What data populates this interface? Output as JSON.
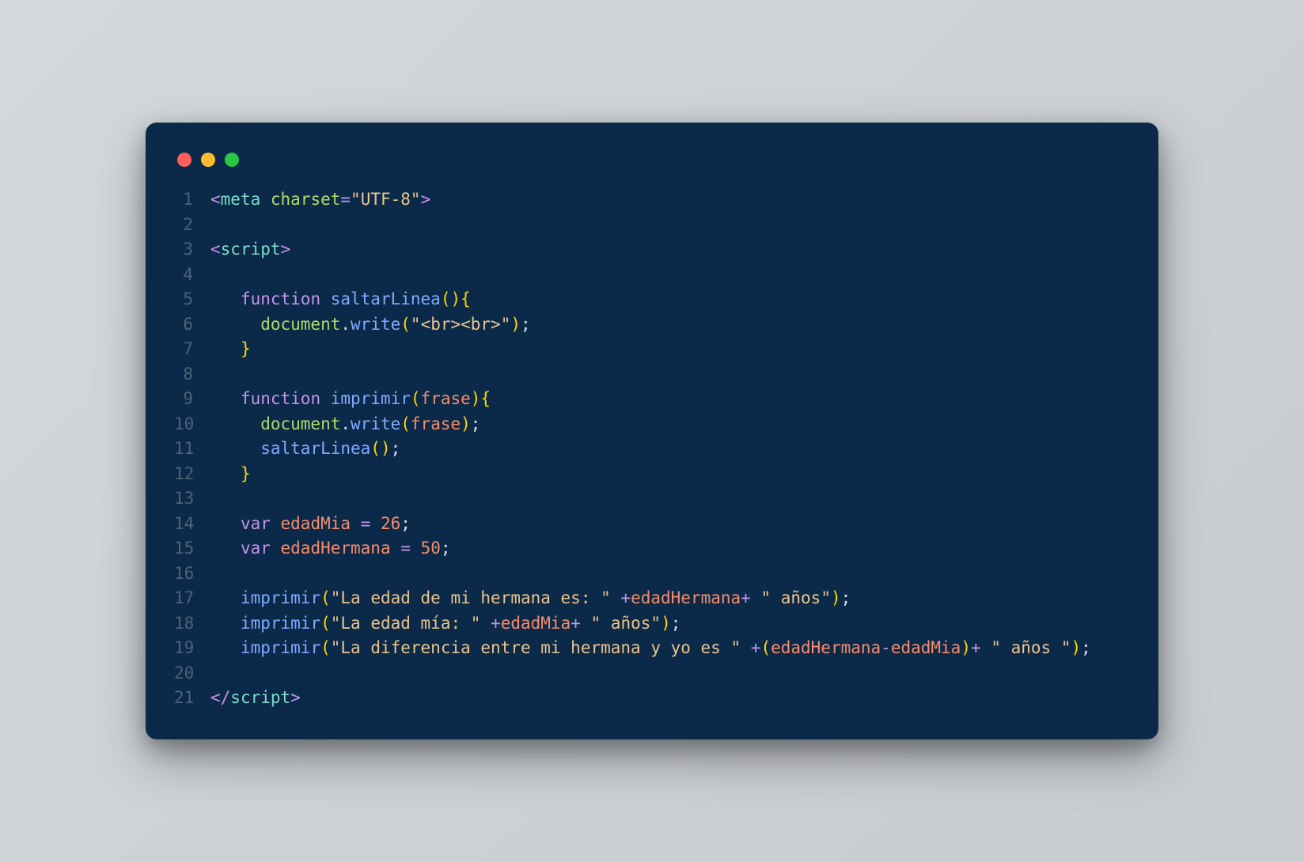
{
  "window": {
    "traffic_lights": [
      "close",
      "minimize",
      "zoom"
    ]
  },
  "code": {
    "lines": [
      {
        "n": "1",
        "tokens": [
          {
            "t": "<",
            "c": "angle"
          },
          {
            "t": "meta ",
            "c": "tag"
          },
          {
            "t": "charset",
            "c": "attr"
          },
          {
            "t": "=",
            "c": "op"
          },
          {
            "t": "\"UTF-8\"",
            "c": "str"
          },
          {
            "t": ">",
            "c": "angle"
          }
        ]
      },
      {
        "n": "2",
        "tokens": []
      },
      {
        "n": "3",
        "tokens": [
          {
            "t": "<",
            "c": "angle"
          },
          {
            "t": "script",
            "c": "tag"
          },
          {
            "t": ">",
            "c": "angle"
          }
        ]
      },
      {
        "n": "4",
        "tokens": []
      },
      {
        "n": "5",
        "tokens": [
          {
            "t": "   ",
            "c": "code"
          },
          {
            "t": "function ",
            "c": "kw"
          },
          {
            "t": "saltarLinea",
            "c": "fn"
          },
          {
            "t": "()",
            "c": "paren"
          },
          {
            "t": "{",
            "c": "brace"
          }
        ]
      },
      {
        "n": "6",
        "tokens": [
          {
            "t": "     ",
            "c": "code"
          },
          {
            "t": "document",
            "c": "obj"
          },
          {
            "t": ".",
            "c": "punct"
          },
          {
            "t": "write",
            "c": "fn"
          },
          {
            "t": "(",
            "c": "paren"
          },
          {
            "t": "\"<br><br>\"",
            "c": "str"
          },
          {
            "t": ")",
            "c": "paren"
          },
          {
            "t": ";",
            "c": "punct"
          }
        ]
      },
      {
        "n": "7",
        "tokens": [
          {
            "t": "   ",
            "c": "code"
          },
          {
            "t": "}",
            "c": "brace"
          }
        ]
      },
      {
        "n": "8",
        "tokens": []
      },
      {
        "n": "9",
        "tokens": [
          {
            "t": "   ",
            "c": "code"
          },
          {
            "t": "function ",
            "c": "kw"
          },
          {
            "t": "imprimir",
            "c": "fn"
          },
          {
            "t": "(",
            "c": "paren"
          },
          {
            "t": "frase",
            "c": "var"
          },
          {
            "t": ")",
            "c": "paren"
          },
          {
            "t": "{",
            "c": "brace"
          }
        ]
      },
      {
        "n": "10",
        "tokens": [
          {
            "t": "     ",
            "c": "code"
          },
          {
            "t": "document",
            "c": "obj"
          },
          {
            "t": ".",
            "c": "punct"
          },
          {
            "t": "write",
            "c": "fn"
          },
          {
            "t": "(",
            "c": "paren"
          },
          {
            "t": "frase",
            "c": "var"
          },
          {
            "t": ")",
            "c": "paren"
          },
          {
            "t": ";",
            "c": "punct"
          }
        ]
      },
      {
        "n": "11",
        "tokens": [
          {
            "t": "     ",
            "c": "code"
          },
          {
            "t": "saltarLinea",
            "c": "fn"
          },
          {
            "t": "()",
            "c": "paren"
          },
          {
            "t": ";",
            "c": "punct"
          }
        ]
      },
      {
        "n": "12",
        "tokens": [
          {
            "t": "   ",
            "c": "code"
          },
          {
            "t": "}",
            "c": "brace"
          }
        ]
      },
      {
        "n": "13",
        "tokens": []
      },
      {
        "n": "14",
        "tokens": [
          {
            "t": "   ",
            "c": "code"
          },
          {
            "t": "var ",
            "c": "kw"
          },
          {
            "t": "edadMia",
            "c": "var"
          },
          {
            "t": " ",
            "c": "code"
          },
          {
            "t": "=",
            "c": "op"
          },
          {
            "t": " ",
            "c": "code"
          },
          {
            "t": "26",
            "c": "num"
          },
          {
            "t": ";",
            "c": "punct"
          }
        ]
      },
      {
        "n": "15",
        "tokens": [
          {
            "t": "   ",
            "c": "code"
          },
          {
            "t": "var ",
            "c": "kw"
          },
          {
            "t": "edadHermana",
            "c": "var"
          },
          {
            "t": " ",
            "c": "code"
          },
          {
            "t": "=",
            "c": "op"
          },
          {
            "t": " ",
            "c": "code"
          },
          {
            "t": "50",
            "c": "num"
          },
          {
            "t": ";",
            "c": "punct"
          }
        ]
      },
      {
        "n": "16",
        "tokens": []
      },
      {
        "n": "17",
        "tokens": [
          {
            "t": "   ",
            "c": "code"
          },
          {
            "t": "imprimir",
            "c": "fn"
          },
          {
            "t": "(",
            "c": "paren"
          },
          {
            "t": "\"La edad de mi hermana es: \"",
            "c": "str"
          },
          {
            "t": " ",
            "c": "code"
          },
          {
            "t": "+",
            "c": "plus"
          },
          {
            "t": "edadHermana",
            "c": "var"
          },
          {
            "t": "+",
            "c": "plus"
          },
          {
            "t": " ",
            "c": "code"
          },
          {
            "t": "\" años\"",
            "c": "str"
          },
          {
            "t": ")",
            "c": "paren"
          },
          {
            "t": ";",
            "c": "punct"
          }
        ]
      },
      {
        "n": "18",
        "tokens": [
          {
            "t": "   ",
            "c": "code"
          },
          {
            "t": "imprimir",
            "c": "fn"
          },
          {
            "t": "(",
            "c": "paren"
          },
          {
            "t": "\"La edad mía: \"",
            "c": "str"
          },
          {
            "t": " ",
            "c": "code"
          },
          {
            "t": "+",
            "c": "plus"
          },
          {
            "t": "edadMia",
            "c": "var"
          },
          {
            "t": "+",
            "c": "plus"
          },
          {
            "t": " ",
            "c": "code"
          },
          {
            "t": "\" años\"",
            "c": "str"
          },
          {
            "t": ")",
            "c": "paren"
          },
          {
            "t": ";",
            "c": "punct"
          }
        ]
      },
      {
        "n": "19",
        "tokens": [
          {
            "t": "   ",
            "c": "code"
          },
          {
            "t": "imprimir",
            "c": "fn"
          },
          {
            "t": "(",
            "c": "paren"
          },
          {
            "t": "\"La diferencia entre mi hermana y yo es \"",
            "c": "str"
          },
          {
            "t": " ",
            "c": "code"
          },
          {
            "t": "+",
            "c": "plus"
          },
          {
            "t": "(",
            "c": "paren"
          },
          {
            "t": "edadHermana",
            "c": "var"
          },
          {
            "t": "-",
            "c": "plus"
          },
          {
            "t": "edadMia",
            "c": "var"
          },
          {
            "t": ")",
            "c": "paren"
          },
          {
            "t": "+",
            "c": "plus"
          },
          {
            "t": " ",
            "c": "code"
          },
          {
            "t": "\" años \"",
            "c": "str"
          },
          {
            "t": ")",
            "c": "paren"
          },
          {
            "t": ";",
            "c": "punct"
          }
        ]
      },
      {
        "n": "20",
        "tokens": []
      },
      {
        "n": "21",
        "tokens": [
          {
            "t": "</",
            "c": "angle"
          },
          {
            "t": "script",
            "c": "tag"
          },
          {
            "t": ">",
            "c": "angle"
          }
        ]
      }
    ]
  }
}
